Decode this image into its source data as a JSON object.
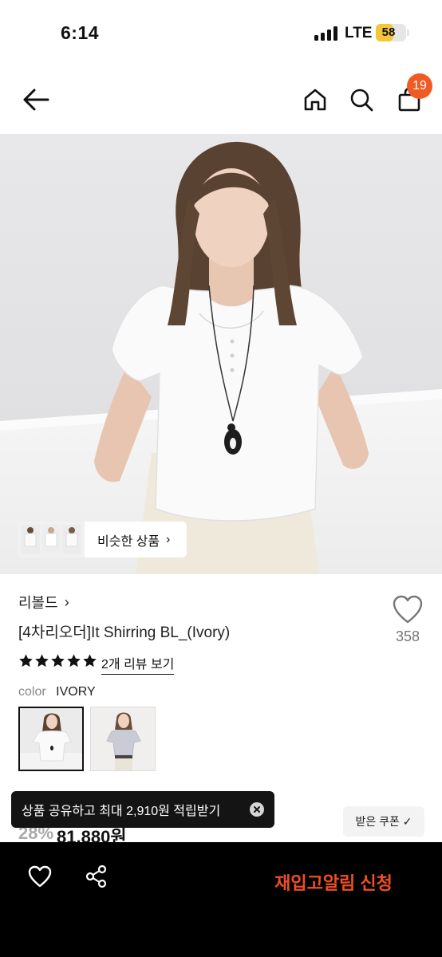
{
  "status_bar": {
    "time": "6:14",
    "network": "LTE",
    "battery": "58",
    "battery_level": 0.58,
    "battery_color": "#f3c737"
  },
  "header": {
    "back_icon": "arrow-left-icon",
    "home_icon": "home-icon",
    "search_icon": "search-icon",
    "cart_icon": "shopping-bag-icon",
    "cart_count": "19",
    "badge_color": "#f15a22"
  },
  "hero": {
    "similar_label": "비슷한 상품",
    "similar_chevron": "›"
  },
  "product": {
    "brand": "리볼드",
    "brand_chevron": "›",
    "name": "[4차리오더]It Shirring BL_(Ivory)",
    "like_count": "358",
    "rating_stars": 5,
    "review_link": "2개 리뷰 보기",
    "color_key": "color",
    "color_value": "IVORY",
    "discount": "28%",
    "price": "81,880원"
  },
  "toast": {
    "text": "상품 공유하고 최대 2,910원 적립받기",
    "close_icon": "close-circle-icon"
  },
  "coupon": {
    "label": "받은 쿠폰 ✓"
  },
  "bottom_bar": {
    "like_icon": "heart-icon",
    "share_icon": "share-icon",
    "restock_label": "재입고알림 신청",
    "accent": "#ef4e24"
  }
}
